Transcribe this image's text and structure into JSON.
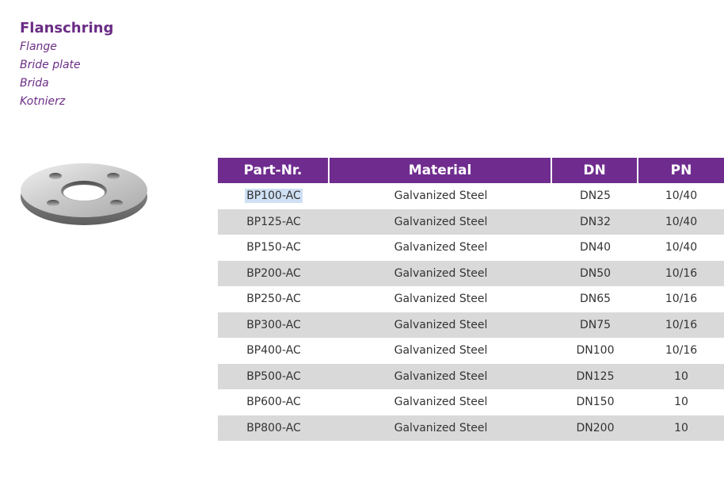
{
  "titles": {
    "main": "Flanschring",
    "sub": [
      "Flange",
      "Bride plate",
      "Brida",
      "Kotnierz"
    ]
  },
  "image": {
    "icon": "flange-plate-image"
  },
  "table": {
    "headers": [
      "Part-Nr.",
      "Material",
      "DN",
      "PN"
    ],
    "rows": [
      [
        "BP100-AC",
        "Galvanized Steel",
        "DN25",
        "10/40"
      ],
      [
        "BP125-AC",
        "Galvanized Steel",
        "DN32",
        "10/40"
      ],
      [
        "BP150-AC",
        "Galvanized Steel",
        "DN40",
        "10/40"
      ],
      [
        "BP200-AC",
        "Galvanized Steel",
        "DN50",
        "10/16"
      ],
      [
        "BP250-AC",
        "Galvanized Steel",
        "DN65",
        "10/16"
      ],
      [
        "BP300-AC",
        "Galvanized Steel",
        "DN75",
        "10/16"
      ],
      [
        "BP400-AC",
        "Galvanized Steel",
        "DN100",
        "10/16"
      ],
      [
        "BP500-AC",
        "Galvanized Steel",
        "DN125",
        "10"
      ],
      [
        "BP600-AC",
        "Galvanized Steel",
        "DN150",
        "10"
      ],
      [
        "BP800-AC",
        "Galvanized Steel",
        "DN200",
        "10"
      ]
    ]
  },
  "colors": {
    "accent": "#6f2c8e",
    "title": "#6b2d86",
    "row_alt": "#d9d9d9",
    "selection": "#cfe0f5"
  }
}
